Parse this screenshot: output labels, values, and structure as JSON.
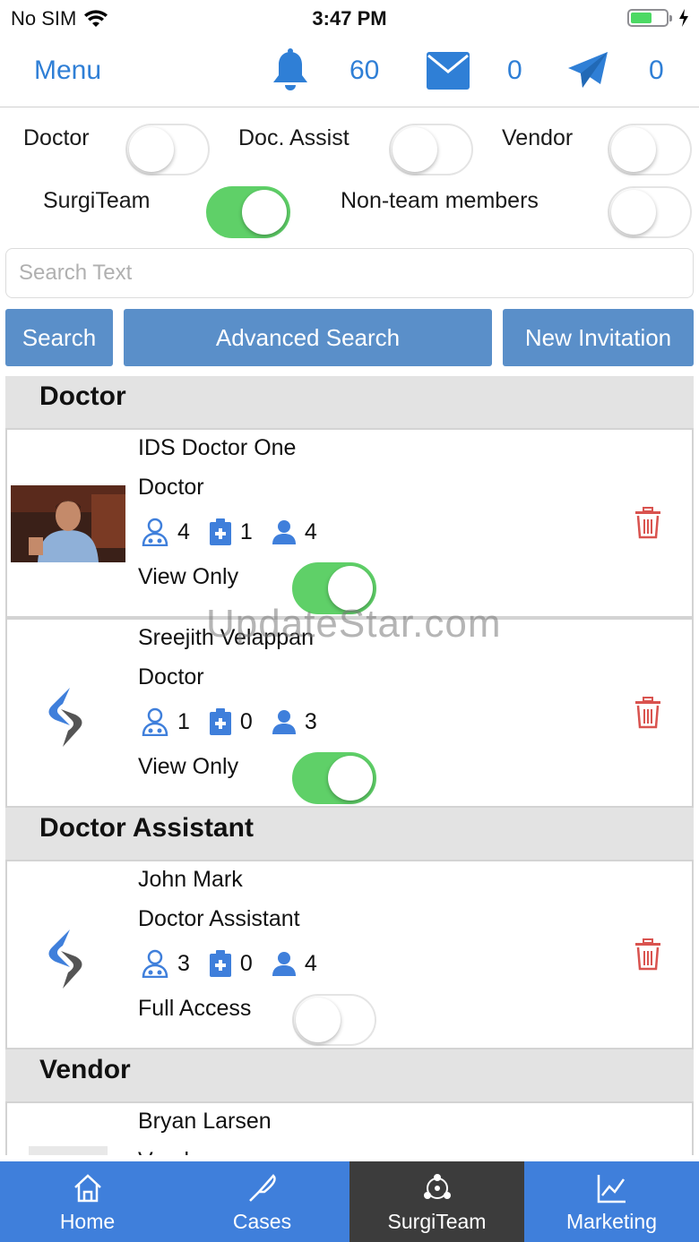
{
  "status": {
    "carrier": "No SIM",
    "time": "3:47 PM"
  },
  "header": {
    "menu_label": "Menu",
    "notifications": "60",
    "messages": "0",
    "sent": "0",
    "accent": "#2f7fd6"
  },
  "filters": {
    "doctor": {
      "label": "Doctor",
      "on": false
    },
    "doc_assist": {
      "label": "Doc. Assist",
      "on": false
    },
    "vendor": {
      "label": "Vendor",
      "on": false
    },
    "surgiteam": {
      "label": "SurgiTeam",
      "on": true
    },
    "non_team": {
      "label": "Non-team members",
      "on": false
    }
  },
  "search": {
    "placeholder": "Search Text"
  },
  "buttons": {
    "search": "Search",
    "advanced": "Advanced Search",
    "invite": "New Invitation"
  },
  "sections": [
    {
      "title": "Doctor"
    },
    {
      "title": "Doctor Assistant"
    },
    {
      "title": "Vendor"
    }
  ],
  "members": [
    {
      "name": "IDS Doctor One",
      "role": "Doctor",
      "doctors": "4",
      "cases": "1",
      "members": "4",
      "access": "View Only",
      "access_on": true
    },
    {
      "name": "Sreejith Velappan",
      "role": "Doctor",
      "doctors": "1",
      "cases": "0",
      "members": "3",
      "access": "View Only",
      "access_on": true
    },
    {
      "name": "John Mark",
      "role": "Doctor Assistant",
      "doctors": "3",
      "cases": "0",
      "members": "4",
      "access": "Full Access",
      "access_on": false
    },
    {
      "name": "Bryan Larsen",
      "role": "Vendor"
    }
  ],
  "watermark": "UpdateStar.com",
  "tabs": [
    {
      "label": "Home",
      "icon": "home-icon"
    },
    {
      "label": "Cases",
      "icon": "scalpel-icon"
    },
    {
      "label": "SurgiTeam",
      "icon": "team-icon",
      "active": true
    },
    {
      "label": "Marketing",
      "icon": "chart-icon"
    }
  ]
}
